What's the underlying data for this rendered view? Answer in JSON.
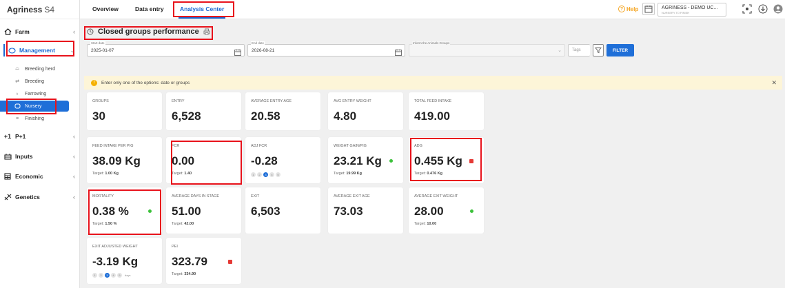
{
  "app": {
    "brand": "Agriness",
    "version": "S4"
  },
  "sidebar": {
    "farm_label": "Farm",
    "management_label": "Management",
    "sub_items": [
      {
        "label": "Breeding herd"
      },
      {
        "label": "Breeding"
      },
      {
        "label": "Farrowing"
      },
      {
        "label": "Nursery"
      },
      {
        "label": "Finishing"
      }
    ],
    "p1_label": "P+1",
    "inputs_label": "Inputs",
    "economic_label": "Economic",
    "genetics_label": "Genetics"
  },
  "topbar": {
    "tabs": [
      {
        "label": "Overview"
      },
      {
        "label": "Data entry"
      },
      {
        "label": "Analysis Center"
      }
    ],
    "help_label": "Help",
    "farm_name": "AGRINESS - DEMO UC...",
    "farm_sub": "NURSERY TO FINISH"
  },
  "page": {
    "title": "Closed groups performance"
  },
  "filters": {
    "start_label": "Start date",
    "start_value": "2025-01-07",
    "end_label": "End date",
    "end_value": "2026-08-21",
    "groups_label": "Inform the Animals Groups",
    "tags_placeholder": "Tags",
    "filter_button": "FILTER"
  },
  "banner": {
    "text": "Enter only one of the options: date or groups"
  },
  "cards": {
    "groups": {
      "label": "GROUPS",
      "value": "30"
    },
    "entry": {
      "label": "ENTRY",
      "value": "6,528"
    },
    "avg_entry_age": {
      "label": "AVERAGE ENTRY AGE",
      "value": "20.58"
    },
    "avg_entry_weight": {
      "label": "AVG ENTRY WEIGHT",
      "value": "4.80"
    },
    "total_feed": {
      "label": "TOTAL FEED INTAKE",
      "value": "419.00"
    },
    "feed_per_pig": {
      "label": "FEED INTAKE PER PIG",
      "value": "38.09 Kg",
      "target_label": "Target:",
      "target": "1.00 Kg"
    },
    "fcr": {
      "label": "FCR",
      "value": "0.00",
      "target_label": "Target:",
      "target": "1.40"
    },
    "adj_fcr": {
      "label": "ADJ FCR",
      "value": "-0.28",
      "pages": [
        "1",
        "2",
        "3",
        "4",
        "5"
      ]
    },
    "weight_gain": {
      "label": "WEIGHT GAIN/PIG",
      "value": "23.21 Kg",
      "target_label": "Target:",
      "target": "19.99 Kg",
      "status": "good"
    },
    "adg": {
      "label": "ADG",
      "value": "0.455 Kg",
      "target_label": "Target:",
      "target": "0.476 Kg",
      "status": "bad"
    },
    "mortality": {
      "label": "MORTALITY",
      "value": "0.38 %",
      "target_label": "Target:",
      "target": "1.50 %",
      "status": "good"
    },
    "avg_days": {
      "label": "AVERAGE DAYS IN STAGE",
      "value": "51.00",
      "target_label": "Target:",
      "target": "42.00"
    },
    "exit": {
      "label": "EXIT",
      "value": "6,503"
    },
    "avg_exit_age": {
      "label": "AVERAGE EXIT AGE",
      "value": "73.03"
    },
    "avg_exit_weight": {
      "label": "AVERAGE EXIT WEIGHT",
      "value": "28.00",
      "target_label": "Target:",
      "target": "10.00",
      "status": "good"
    },
    "exit_adj_weight": {
      "label": "EXIT ADJUSTED WEIGHT",
      "value": "-3.19 Kg",
      "pages": [
        "1",
        "2",
        "3",
        "4",
        "5"
      ],
      "unit": "days"
    },
    "pei": {
      "label": "PEI",
      "value": "323.79",
      "target_label": "Target:",
      "target": "334.90",
      "status": "bad"
    }
  },
  "colors": {
    "accent": "#1f6fd8",
    "highlight": "#e8121b",
    "good": "#3cc13b",
    "bad": "#e53935",
    "banner": "#fdf5d8"
  }
}
